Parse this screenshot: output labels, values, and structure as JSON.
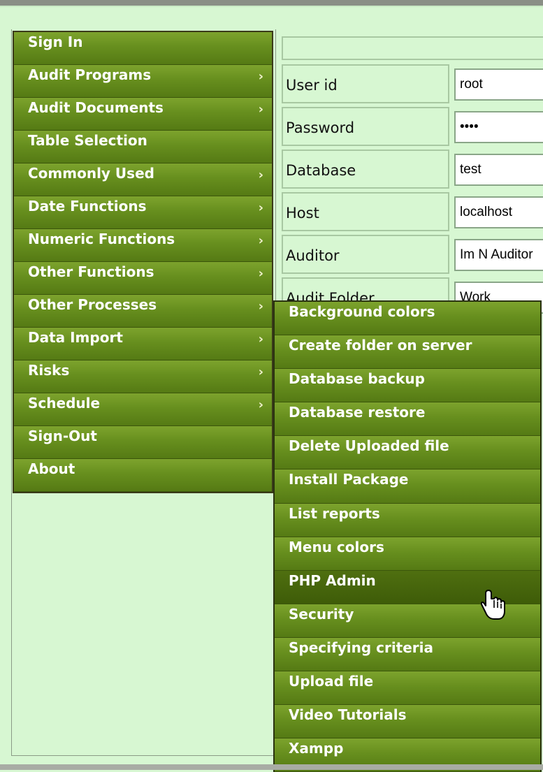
{
  "main_menu": {
    "items": [
      {
        "label": "Sign In",
        "has_submenu": false
      },
      {
        "label": "Audit Programs",
        "has_submenu": true
      },
      {
        "label": "Audit Documents",
        "has_submenu": true
      },
      {
        "label": "Table Selection",
        "has_submenu": false
      },
      {
        "label": "Commonly Used",
        "has_submenu": true
      },
      {
        "label": "Date Functions",
        "has_submenu": true
      },
      {
        "label": "Numeric Functions",
        "has_submenu": true
      },
      {
        "label": "Other Functions",
        "has_submenu": true
      },
      {
        "label": "Other Processes",
        "has_submenu": true
      },
      {
        "label": "Data Import",
        "has_submenu": true
      },
      {
        "label": "Risks",
        "has_submenu": true
      },
      {
        "label": "Schedule",
        "has_submenu": true
      },
      {
        "label": "Sign-Out",
        "has_submenu": false
      },
      {
        "label": "About",
        "has_submenu": false
      }
    ],
    "arrow_glyph": "›"
  },
  "form": {
    "fields": [
      {
        "label": "User id",
        "value": "root",
        "type": "text"
      },
      {
        "label": "Password",
        "value": "test",
        "type": "password"
      },
      {
        "label": "Database",
        "value": "test",
        "type": "text"
      },
      {
        "label": "Host",
        "value": "localhost",
        "type": "text"
      },
      {
        "label": "Auditor",
        "value": "Im N Auditor",
        "type": "text"
      },
      {
        "label": "Audit Folder",
        "value": "Work",
        "type": "text"
      }
    ]
  },
  "submenu": {
    "parent": "Other Processes",
    "items": [
      {
        "label": "Background colors"
      },
      {
        "label": "Create folder on server"
      },
      {
        "label": "Database backup"
      },
      {
        "label": "Database restore"
      },
      {
        "label": "Delete Uploaded file"
      },
      {
        "label": "Install Package"
      },
      {
        "label": "List reports"
      },
      {
        "label": "Menu colors"
      },
      {
        "label": "PHP Admin",
        "hovered": true
      },
      {
        "label": "Security"
      },
      {
        "label": "Specifying criteria"
      },
      {
        "label": "Upload file"
      },
      {
        "label": "Video Tutorials"
      },
      {
        "label": "Xampp"
      }
    ]
  },
  "colors": {
    "page_background": "#d7f7d2",
    "menu_green": "#678f1e",
    "menu_text": "#ffffff",
    "hover_green": "#3e5c08"
  },
  "cursor": "hand-pointer-icon"
}
